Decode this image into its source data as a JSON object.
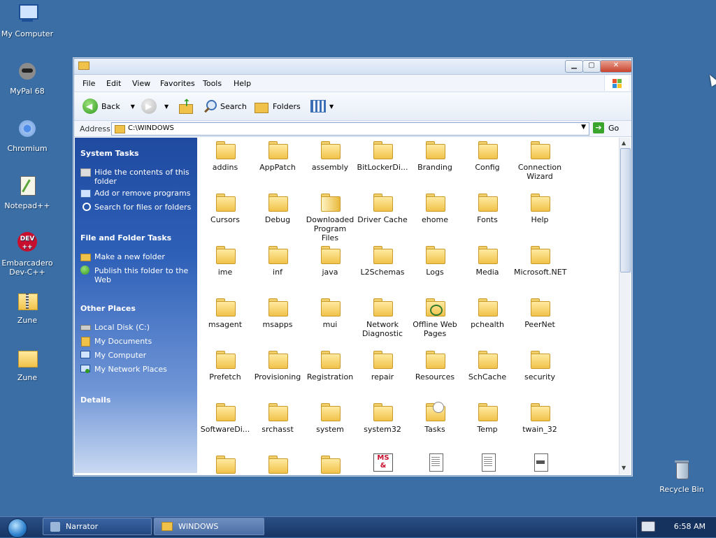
{
  "desktop": {
    "icons": [
      {
        "label": "My Computer"
      },
      {
        "label": "MyPal 68"
      },
      {
        "label": "Chromium"
      },
      {
        "label": "Notepad++"
      },
      {
        "label": "Embarcadero Dev-C++"
      },
      {
        "label": "Zune"
      },
      {
        "label": "Zune"
      },
      {
        "label": "Recycle Bin"
      }
    ]
  },
  "window": {
    "menu": [
      "File",
      "Edit",
      "View",
      "Favorites",
      "Tools",
      "Help"
    ],
    "toolbar": {
      "back": "Back",
      "search": "Search",
      "folders": "Folders"
    },
    "address": {
      "label": "Address",
      "value": "C:\\WINDOWS",
      "go": "Go"
    },
    "taskpane": {
      "system_tasks": {
        "title": "System Tasks",
        "items": [
          "Hide the contents of this folder",
          "Add or remove programs",
          "Search for files or folders"
        ]
      },
      "file_folder_tasks": {
        "title": "File and Folder Tasks",
        "items": [
          "Make a new folder",
          "Publish this folder to the Web"
        ]
      },
      "other_places": {
        "title": "Other Places",
        "items": [
          "Local Disk (C:)",
          "My Documents",
          "My Computer",
          "My Network Places"
        ]
      },
      "details": {
        "title": "Details"
      }
    },
    "files": [
      "addins",
      "AppPatch",
      "assembly",
      "BitLockerDi...",
      "Branding",
      "Config",
      "Connection Wizard",
      "Cursors",
      "Debug",
      "Downloaded Program Files",
      "Driver Cache",
      "ehome",
      "Fonts",
      "Help",
      "ime",
      "inf",
      "java",
      "L2Schemas",
      "Logs",
      "Media",
      "Microsoft.NET",
      "msagent",
      "msapps",
      "mui",
      "Network Diagnostic",
      "Offline Web Pages",
      "pchealth",
      "PeerNet",
      "Prefetch",
      "Provisioning",
      "Registration",
      "repair",
      "Resources",
      "SchCache",
      "security",
      "SoftwareDi...",
      "srchasst",
      "system",
      "system32",
      "Tasks",
      "Temp",
      "twain_32"
    ]
  },
  "taskbar": {
    "tasks": [
      "Narrator",
      "WINDOWS"
    ],
    "clock": "6:58 AM"
  },
  "colors": {
    "desktop": "#3a6ea5",
    "taskpane_top": "#1f4aa0",
    "folder": "#f1c24a"
  }
}
